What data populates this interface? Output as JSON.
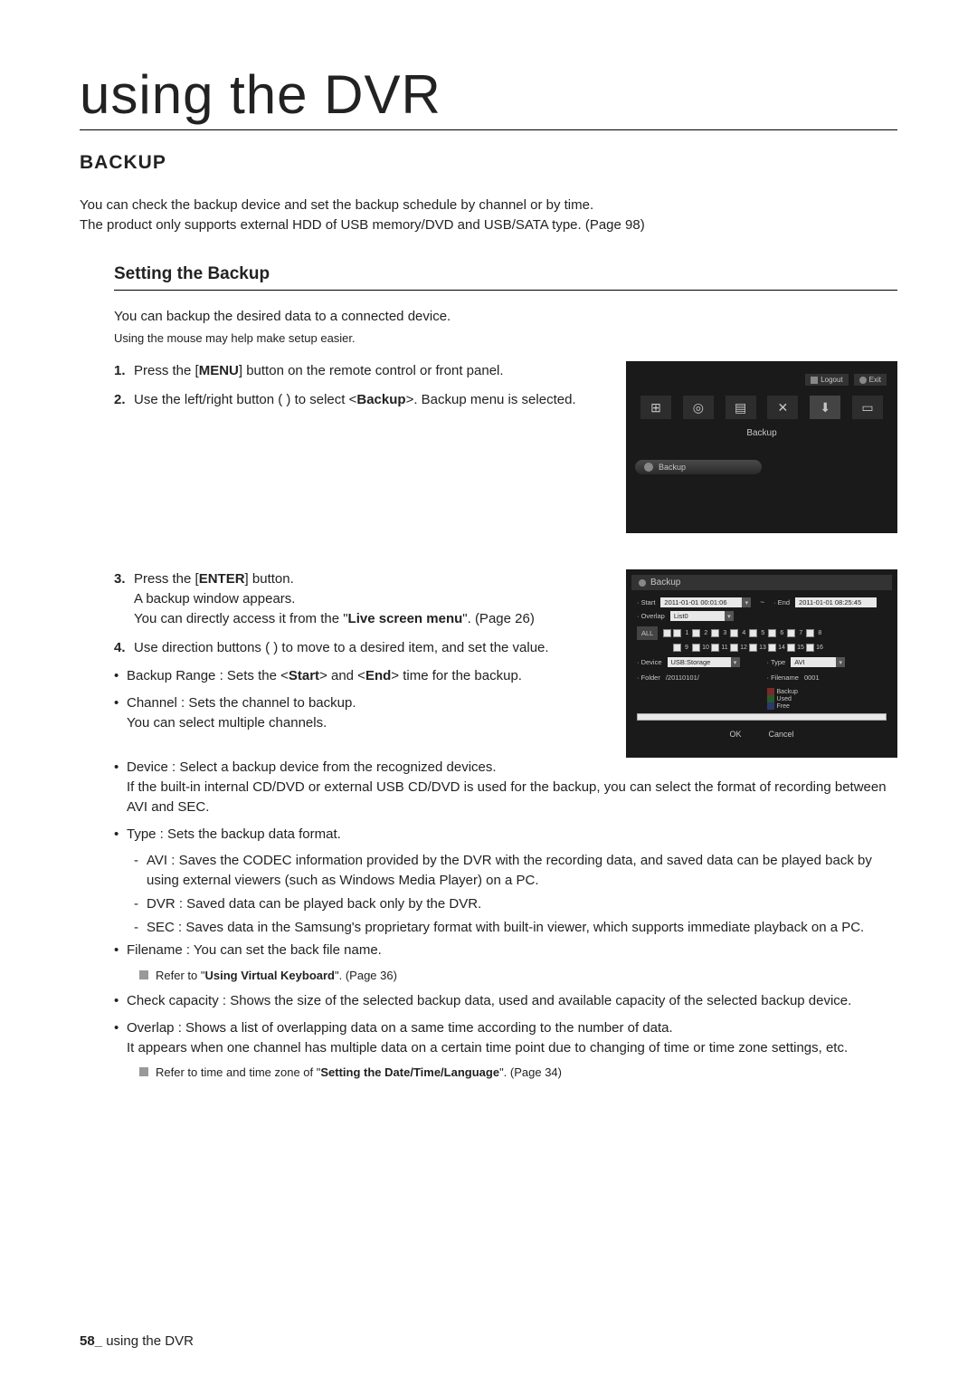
{
  "page_title": "using the DVR",
  "section": "BACKUP",
  "intro_lines": [
    "You can check the backup device and set the backup schedule by channel or by time.",
    "The product only supports external HDD of USB memory/DVD and USB/SATA type. (Page 98)"
  ],
  "subsection_title": "Setting the Backup",
  "lead": "You can backup the desired data to a connected device.",
  "mouse_hint": "Using the mouse may help make setup easier.",
  "steps_block1": [
    {
      "n": "1.",
      "pre": "Press the [",
      "bold": "MENU",
      "post": "] button on the remote control or front panel."
    },
    {
      "n": "2.",
      "pre": "Use the left/right button (        ) to select <",
      "bold": "Backup",
      "post": ">. Backup menu is selected."
    }
  ],
  "steps_block2": [
    {
      "n": "3.",
      "pre": "Press the [",
      "bold": "ENTER",
      "post": "] button.",
      "extra1": "A backup window appears.",
      "extra2_pre": "You can directly access it from the \"",
      "extra2_bold": "Live screen menu",
      "extra2_post": "\". (Page 26)"
    },
    {
      "n": "4.",
      "text": "Use direction buttons (            ) to move to a desired item, and set the value."
    }
  ],
  "bullets_col": [
    {
      "label": "Backup Range : Sets the <",
      "bold1": "Start",
      "mid": "> and <",
      "bold2": "End",
      "post": "> time for the backup."
    },
    {
      "label": "Channel : Sets the channel to backup.",
      "sub": "You can select multiple channels."
    }
  ],
  "bullets_full": [
    {
      "label": "Device : Select a backup device from the recognized devices.",
      "sub": "If the built-in internal CD/DVD or external USB CD/DVD is used for the backup, you can select the format of recording between AVI and SEC."
    },
    {
      "label": "Type : Sets the backup data format.",
      "dashes": [
        "AVI : Saves the CODEC information provided by the DVR with the recording data, and saved data can be played back by using external viewers (such as Windows Media Player) on a PC.",
        "DVR : Saved data can be played back only by the DVR.",
        "SEC : Saves data in the Samsung's proprietary format with built-in viewer, which supports immediate playback on a PC."
      ]
    },
    {
      "label": "Filename : You can set the back file name.",
      "note_pre": "Refer to \"",
      "note_bold": "Using Virtual Keyboard",
      "note_post": "\". (Page 36)"
    },
    {
      "label": "Check capacity : Shows the size of the selected backup data, used and available capacity of the selected backup device."
    },
    {
      "label": "Overlap : Shows a list of overlapping data on a same time according to the number of data.",
      "sub": "It appears when one channel has multiple data on a certain time point due to changing of time or time zone settings, etc.",
      "note_pre": "Refer to time and time zone of \"",
      "note_bold": "Setting the Date/Time/Language",
      "note_post": "\". (Page 34)"
    }
  ],
  "screenshot1": {
    "logout": "Logout",
    "exit": "Exit",
    "label": "Backup",
    "bar": "Backup"
  },
  "screenshot2": {
    "title": "Backup",
    "start_lbl": "· Start",
    "start_val": "2011-01-01 00:01:06",
    "end_lbl": "· End",
    "end_val": "2011-01-01 08:25:45",
    "overlap_lbl": "· Overlap",
    "overlap_val": "List0",
    "all": "ALL",
    "channels": [
      "1",
      "2",
      "3",
      "4",
      "5",
      "6",
      "7",
      "8",
      "9",
      "10",
      "11",
      "12",
      "13",
      "14",
      "15",
      "16"
    ],
    "device_lbl": "· Device",
    "device_val": "USB:Storage",
    "folder_lbl": "· Folder",
    "folder_val": "/20110101/",
    "type_lbl": "· Type",
    "type_val": "AVI",
    "filename_lbl": "· Filename",
    "filename_val": "0001",
    "legend": [
      "Backup",
      "Used",
      "Free"
    ],
    "legend_colors": [
      "#7a2a2a",
      "#2a5a2a",
      "#2a3a6a"
    ],
    "ok": "OK",
    "cancel": "Cancel"
  },
  "footer": {
    "page": "58_",
    "text": " using the DVR"
  }
}
